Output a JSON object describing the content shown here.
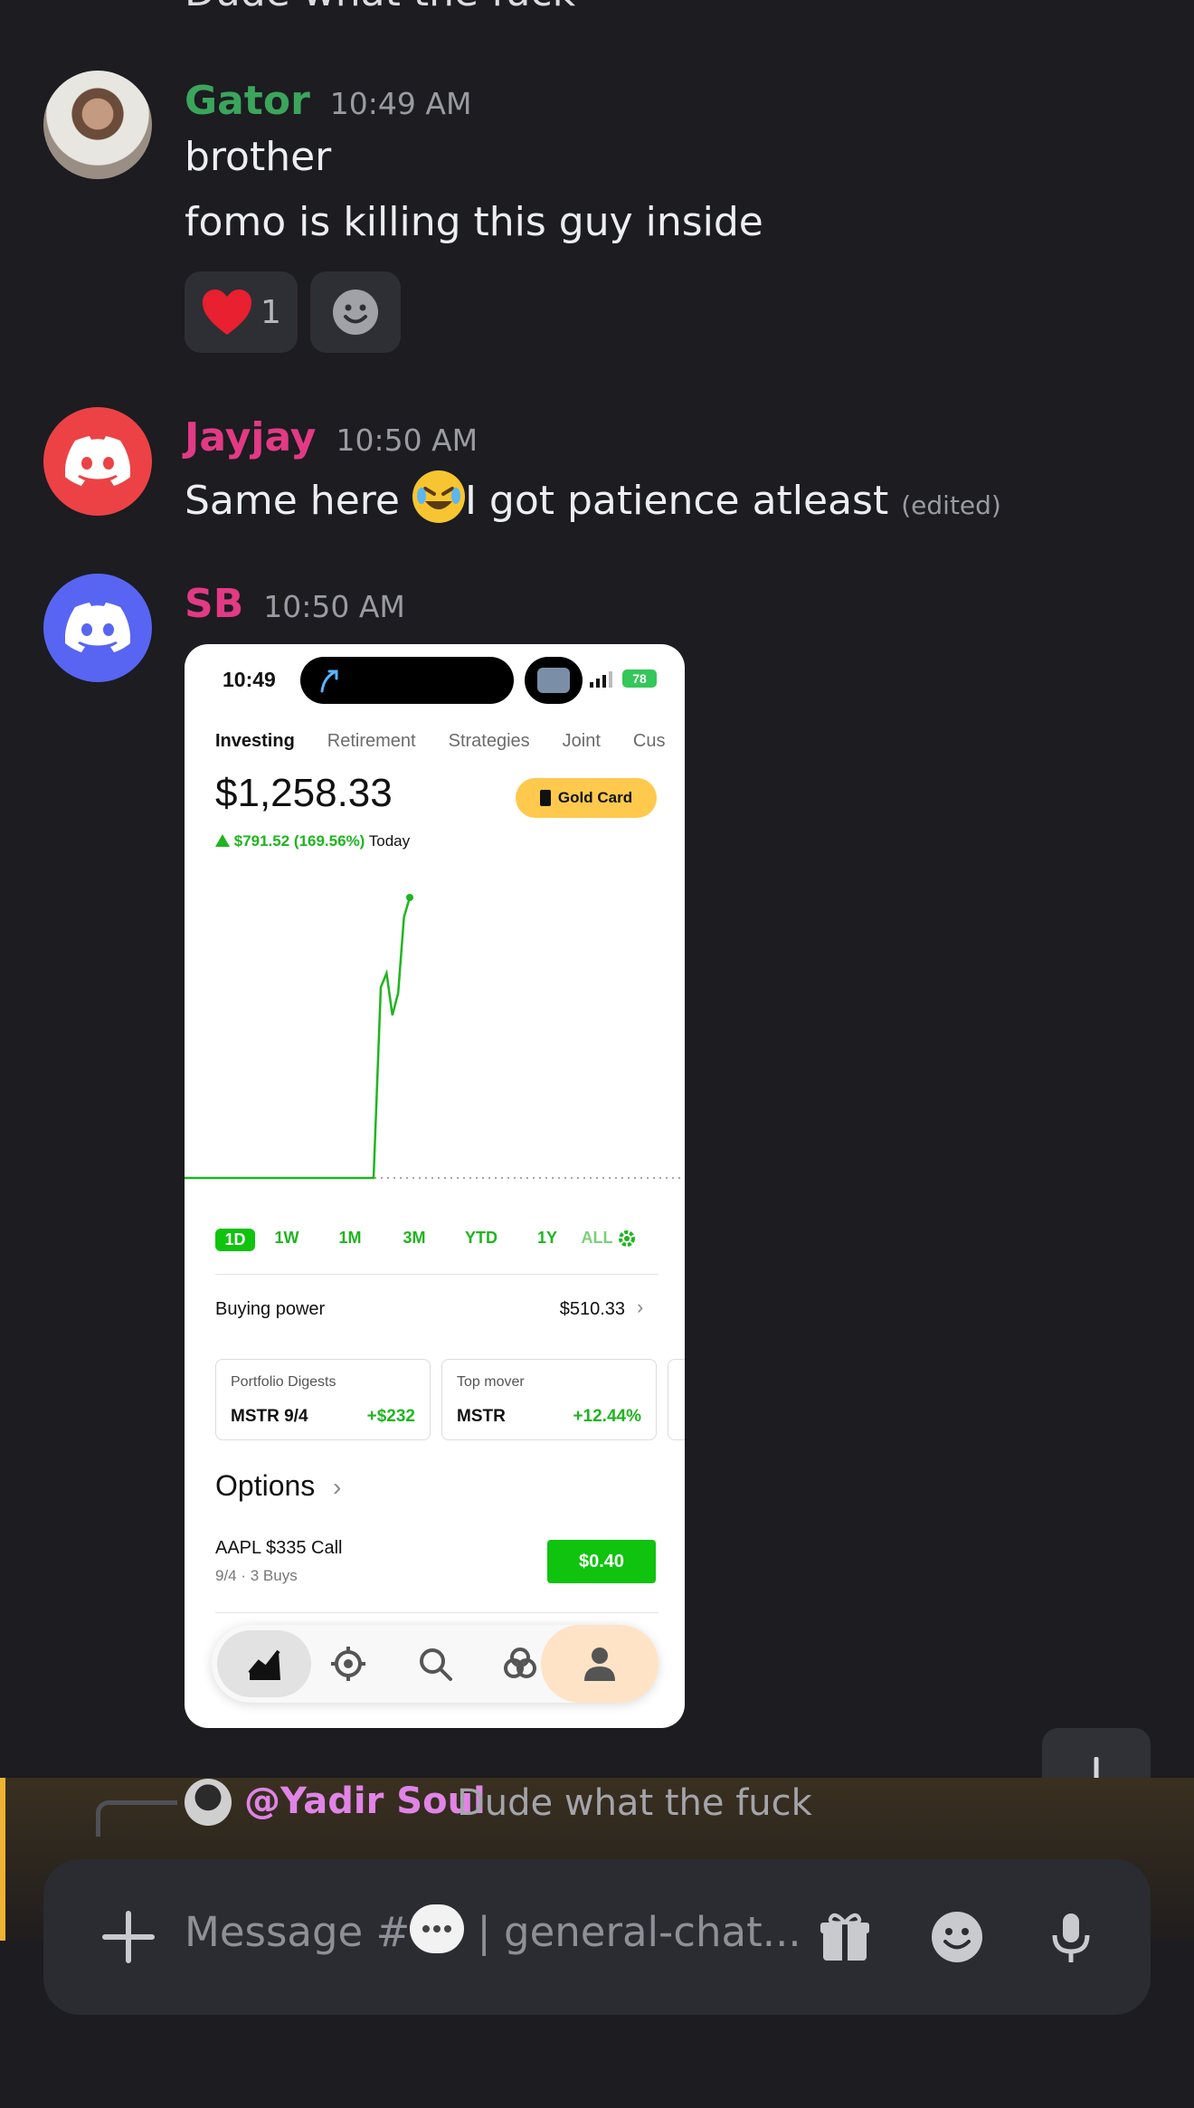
{
  "partial_top": {
    "text": "Dude what the fuck"
  },
  "messages": [
    {
      "username": "Gator",
      "username_color": "#3ba55c",
      "time": "10:49 AM",
      "lines": [
        "brother",
        "fomo is killing this guy inside"
      ],
      "reactions": [
        {
          "emoji": "heart",
          "count": "1"
        }
      ]
    },
    {
      "username": "Jayjay",
      "username_color": "#e23a84",
      "time": "10:50 AM",
      "line_before": "Same here ",
      "line_after": "I got patience atleast",
      "edited": "(edited)",
      "emoji": "rolling-on-floor-laughing"
    },
    {
      "username": "SB",
      "username_color": "#e23a84",
      "time": "10:50 AM"
    }
  ],
  "screenshot": {
    "status_time": "10:49",
    "battery": "78",
    "tabs": [
      "Investing",
      "Retirement",
      "Strategies",
      "Joint",
      "Cus"
    ],
    "balance": "$1,258.33",
    "gold_card": "Gold Card",
    "change_amount": "$791.52 (169.56%)",
    "change_period": "Today",
    "ranges": [
      "1D",
      "1W",
      "1M",
      "3M",
      "YTD",
      "1Y",
      "ALL"
    ],
    "buying_power_label": "Buying power",
    "buying_power_value": "$510.33",
    "cards": [
      {
        "title": "Portfolio Digests",
        "symbol": "MSTR 9/4",
        "value": "+$232"
      },
      {
        "title": "Top mover",
        "symbol": "MSTR",
        "value": "+12.44%"
      }
    ],
    "options_heading": "Options",
    "option_name": "AAPL $335 Call",
    "option_sub": "9/4 · 3 Buys",
    "option_price": "$0.40",
    "chart_data": {
      "type": "line",
      "series": [
        {
          "values": [
            0,
            0,
            0,
            0,
            0,
            0,
            0,
            0,
            0,
            0,
            0,
            0,
            0,
            0,
            0,
            0,
            0,
            0,
            0,
            0,
            0,
            0,
            0,
            0,
            0,
            0,
            0,
            0.68,
            0.73,
            0.58,
            0.66,
            0.93,
            1.0
          ]
        }
      ],
      "line_color": "#1fb51f"
    }
  },
  "reply": {
    "username": "@Yadir Soul",
    "text": "Dude what the fuck"
  },
  "composer": {
    "placeholder_before": "Message #",
    "placeholder_after": " | general-chat..."
  },
  "icons": [
    "plus-icon",
    "gift-icon",
    "emoji-icon",
    "microphone-icon",
    "arrow-down-icon"
  ]
}
